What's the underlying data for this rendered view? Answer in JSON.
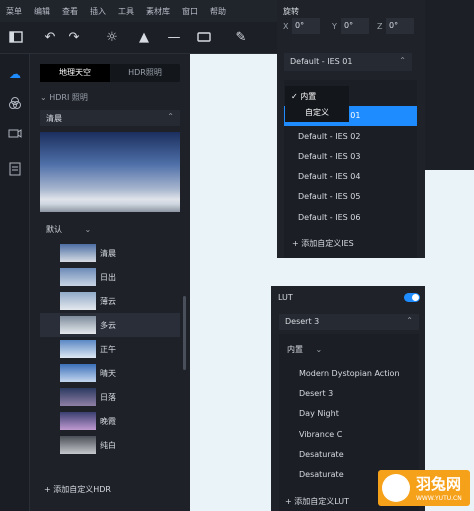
{
  "menu": [
    "菜单",
    "编辑",
    "查看",
    "插入",
    "工具",
    "素材库",
    "窗口",
    "帮助"
  ],
  "toolbar_icons": [
    "sidebar-toggle-icon",
    "undo-icon",
    "redo-icon",
    "sun-icon",
    "cone-icon",
    "line-icon",
    "rectangle-icon",
    "eyedropper-icon"
  ],
  "sidebar_icons": [
    "cloud-icon",
    "circles-icon",
    "camera-icon",
    "document-icon"
  ],
  "env_tabs": [
    "地理天空",
    "HDR照明"
  ],
  "hdr_section_label": "HDRI 照明",
  "hdr_selected": "清晨",
  "hdr_category": "默认",
  "hdr_items": [
    {
      "name": "清晨",
      "grad": "linear-gradient(#4d6ea4,#d6dbe4)"
    },
    {
      "name": "日出",
      "grad": "linear-gradient(#6c8bb8,#c9d4e4)"
    },
    {
      "name": "薄云",
      "grad": "linear-gradient(#90aac8,#e4e8ee)"
    },
    {
      "name": "多云",
      "grad": "linear-gradient(#7e8c9c,#e6e9ed)"
    },
    {
      "name": "正午",
      "grad": "linear-gradient(#5a87c4,#dfe8f3)"
    },
    {
      "name": "晴天",
      "grad": "linear-gradient(#3b6fba,#c4d6ee)"
    },
    {
      "name": "日落",
      "grad": "linear-gradient(#2b3a60,#8f7fa6)"
    },
    {
      "name": "晚霞",
      "grad": "linear-gradient(#3a3f70,#c09ad0)"
    },
    {
      "name": "纯白",
      "grad": "linear-gradient(#4a4e56,#c5c8cc)"
    }
  ],
  "hdr_hovered": "多云",
  "add_hdr": "添加自定义HDR",
  "rotation": {
    "title": "旋转",
    "x_label": "X",
    "x_value": "0°",
    "y_label": "Y",
    "y_value": "0°",
    "z_label": "Z",
    "z_value": "0°"
  },
  "ies_selected": "Default - IES 01",
  "ies_popup": [
    "内置",
    "自定义"
  ],
  "ies_items": [
    "Default - IES 01",
    "Default - IES 02",
    "Default - IES 03",
    "Default - IES 04",
    "Default - IES 05",
    "Default - IES 06"
  ],
  "add_ies": "添加自定义IES",
  "lut": {
    "title": "LUT",
    "enabled": true,
    "selected": "Desert 3",
    "category": "内置",
    "items": [
      "Modern Dystopian Action",
      "Desert 3",
      "Day Night",
      "Vibrance C",
      "Desaturate",
      "Desaturate"
    ],
    "add": "添加自定义LUT"
  },
  "colors": {
    "accent": "#1e8cff",
    "panel": "#1f2329",
    "canvas": "#eaf3f8",
    "watermark": "#f6a11a"
  },
  "watermark": {
    "title": "羽兔网",
    "url": "WWW.YUTU.CN"
  }
}
